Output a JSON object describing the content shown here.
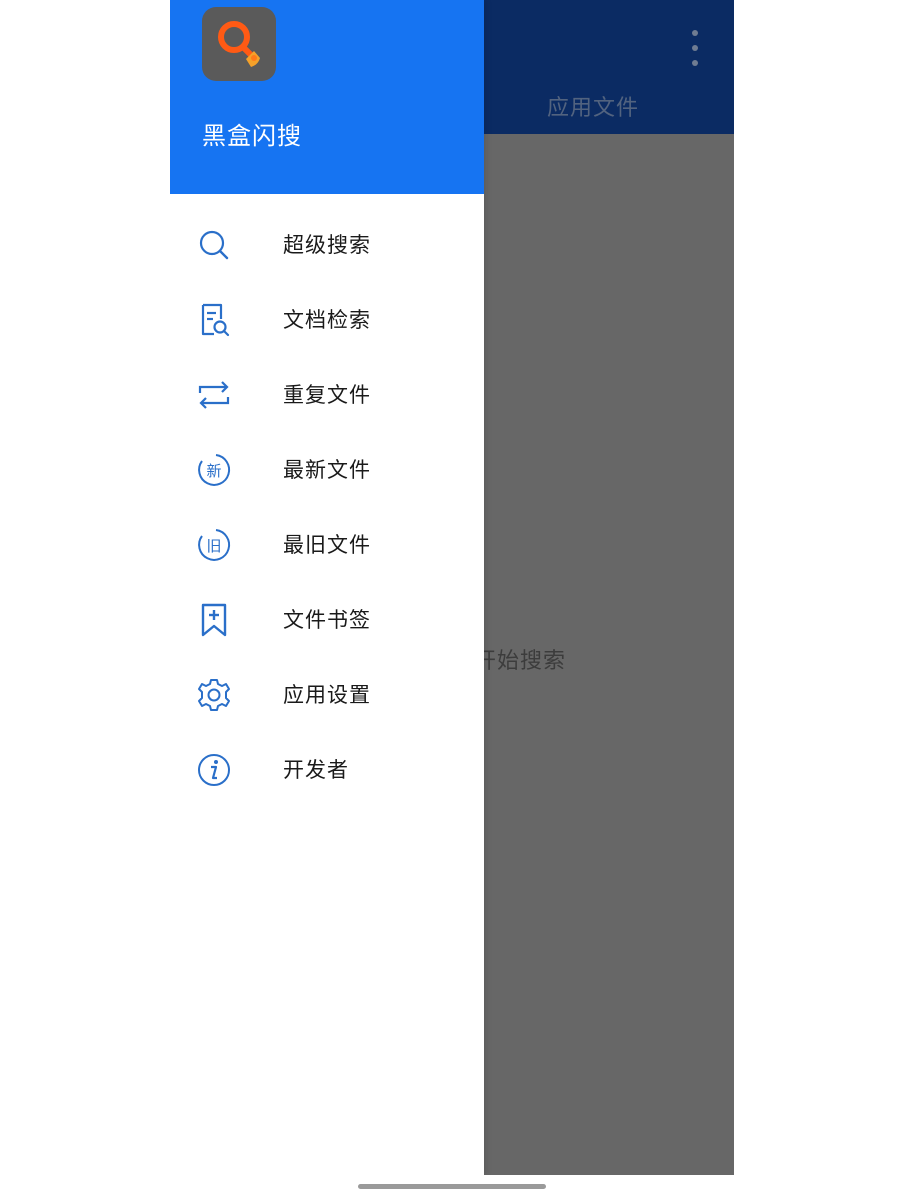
{
  "app": {
    "name": "黑盒闪搜",
    "logo_icon": "magnifier-logo-icon",
    "header_color": "#1674f2",
    "accent_color": "#2a6fc9"
  },
  "background_app": {
    "tab_label": "应用文件",
    "empty_hint": "开始搜索",
    "overflow_icon": "more-vertical-icon"
  },
  "drawer": {
    "items": [
      {
        "label": "超级搜索",
        "icon": "search-icon"
      },
      {
        "label": "文档检索",
        "icon": "document-search-icon"
      },
      {
        "label": "重复文件",
        "icon": "repeat-arrows-icon"
      },
      {
        "label": "最新文件",
        "icon": "new-badge-icon"
      },
      {
        "label": "最旧文件",
        "icon": "old-badge-icon"
      },
      {
        "label": "文件书签",
        "icon": "bookmark-add-icon"
      },
      {
        "label": "应用设置",
        "icon": "gear-icon"
      },
      {
        "label": "开发者",
        "icon": "info-icon"
      }
    ]
  }
}
